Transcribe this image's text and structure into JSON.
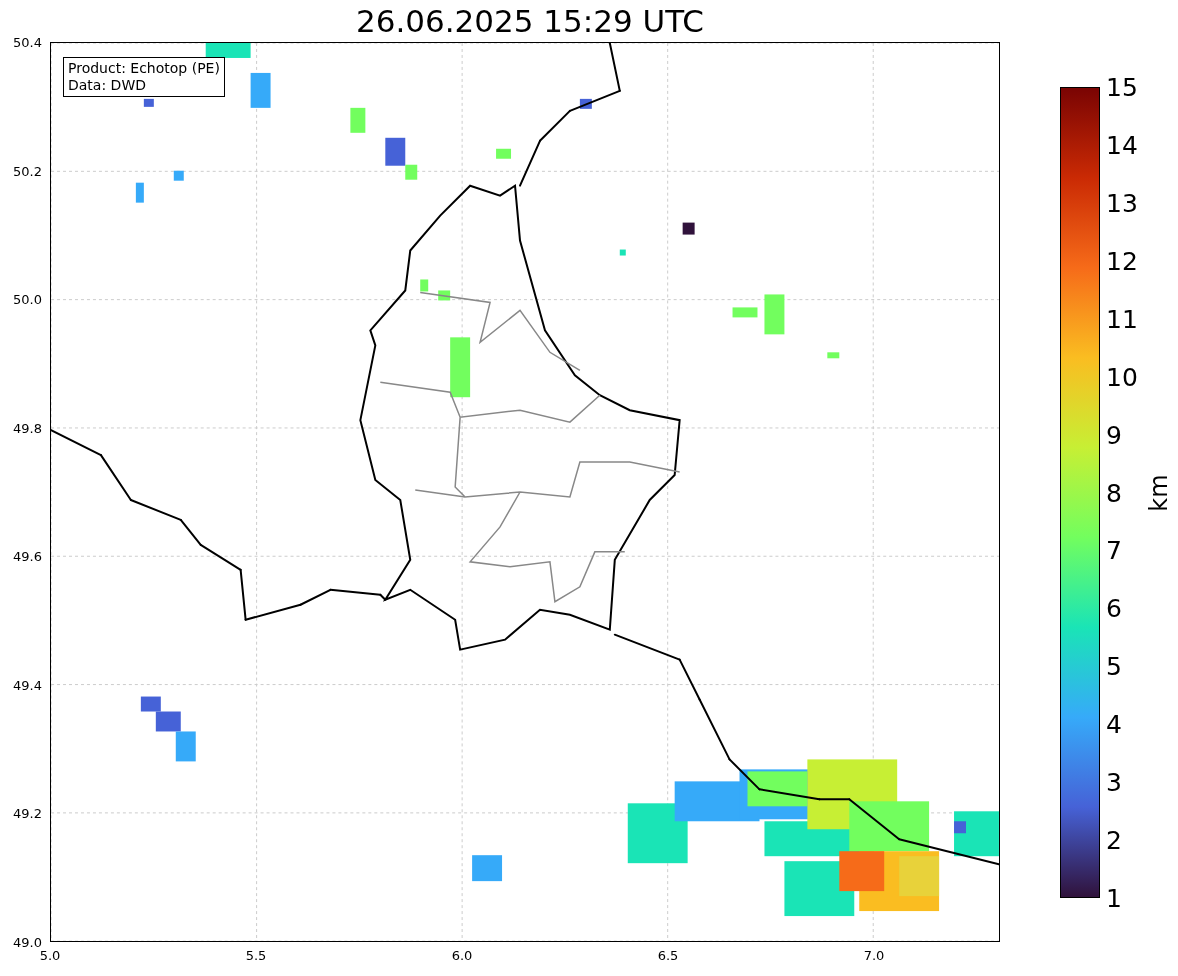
{
  "title": "26.06.2025 15:29 UTC",
  "map": {
    "info_lines": [
      "Product: Echotop (PE)",
      "Data: DWD"
    ],
    "x_ticks": [
      "5.0",
      "5.5",
      "6.0",
      "6.5",
      "7.0"
    ],
    "y_ticks": [
      "50.4",
      "50.2",
      "50.0",
      "49.8",
      "49.6",
      "49.4",
      "49.2",
      "49.0"
    ]
  },
  "colorbar": {
    "label": "km",
    "ticks": [
      "15",
      "14",
      "13",
      "12",
      "11",
      "10",
      "9",
      "8",
      "7",
      "6",
      "5",
      "4",
      "3",
      "2",
      "1"
    ]
  }
}
